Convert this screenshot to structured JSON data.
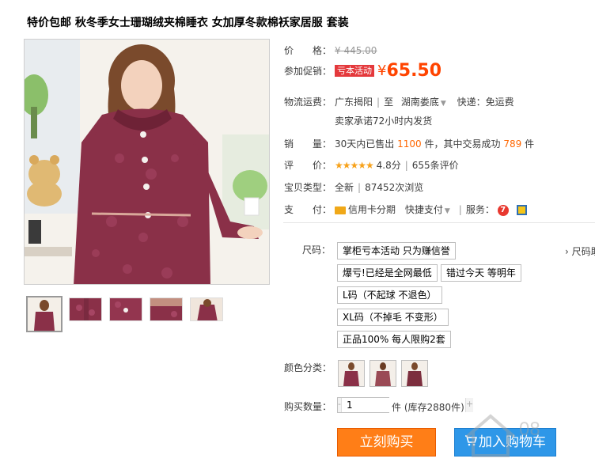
{
  "product": {
    "title": "特价包邮 秋冬季女士珊瑚绒夹棉睡衣 女加厚冬款棉袄家居服 套装"
  },
  "price": {
    "label": "价　　格：",
    "original": "¥ 445.00"
  },
  "promotion": {
    "label": "参加促销：",
    "tag": "亏本活动",
    "currency": "¥",
    "price": "65.50"
  },
  "shipping": {
    "label": "物流运费：",
    "origin": "广东揭阳",
    "to": "至",
    "destination": "湖南娄底",
    "express": "快递：免运费",
    "promise": "卖家承诺72小时内发货"
  },
  "sales": {
    "label": "销　　量：",
    "prefix": "30天内已售出",
    "count": "1100",
    "mid": "件，其中交易成功",
    "success": "789",
    "suffix": "件"
  },
  "rating": {
    "label": "评　　价：",
    "stars": "★★★★★",
    "score": "4.8分",
    "reviews": "655条评价"
  },
  "item_type": {
    "label": "宝贝类型：",
    "condition": "全新",
    "views": "87452次浏览"
  },
  "payment": {
    "label": "支　　付：",
    "installment": "信用卡分期",
    "quickpay": "快捷支付",
    "service_label": "服务："
  },
  "size": {
    "label": "尺码：",
    "guide": "› 尺码助手",
    "options": [
      "掌柜亏本活动 只为赚信誉",
      "爆亏!已经是全网最低",
      "错过今天 等明年",
      "L码（不起球 不退色）",
      "XL码（不掉毛 不变形）",
      "正品100% 每人限购2套"
    ]
  },
  "color": {
    "label": "颜色分类："
  },
  "quantity": {
    "label": "购买数量：",
    "value": "1",
    "minus": "-",
    "plus": "+",
    "unit": "件",
    "stock": "(库存2880件)"
  },
  "actions": {
    "buy": "立刻购买",
    "cart": "加入购物车"
  },
  "colors": {
    "accent": "#ff4400",
    "buy_button": "#ff7e17",
    "cart_button": "#2e97e8",
    "promo_tag": "#e4393c",
    "pajama": "#8a3048"
  }
}
